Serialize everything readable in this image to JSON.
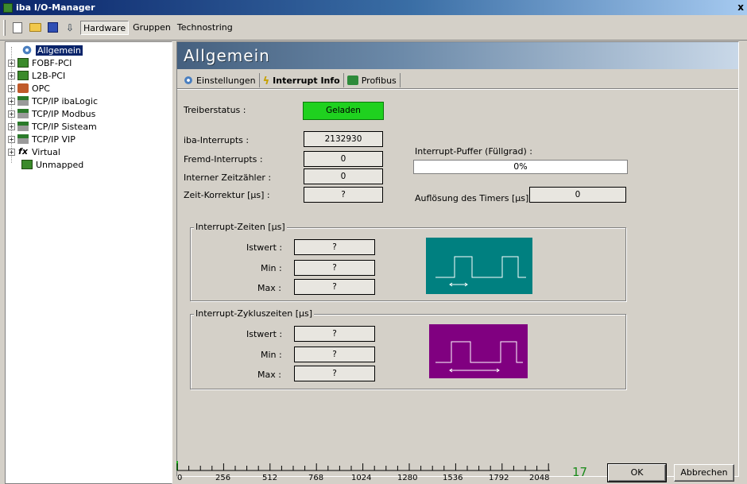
{
  "window": {
    "title": "iba I/O-Manager",
    "close": "x"
  },
  "toolbar": {
    "items": [
      "Hardware",
      "Gruppen",
      "Technostring"
    ]
  },
  "tree": {
    "items": [
      {
        "label": "Allgemein",
        "icon": "gear-icon",
        "expander": ""
      },
      {
        "label": "FOBF-PCI",
        "icon": "board-icon",
        "expander": "+"
      },
      {
        "label": "L2B-PCI",
        "icon": "board-icon",
        "expander": "+"
      },
      {
        "label": "OPC",
        "icon": "opc-icon",
        "expander": "+"
      },
      {
        "label": "TCP/IP ibaLogic",
        "icon": "network-icon",
        "expander": "+"
      },
      {
        "label": "TCP/IP Modbus",
        "icon": "network-icon",
        "expander": "+"
      },
      {
        "label": "TCP/IP Sisteam",
        "icon": "network-icon",
        "expander": "+"
      },
      {
        "label": "TCP/IP VIP",
        "icon": "network-icon",
        "expander": "+"
      },
      {
        "label": "Virtual",
        "icon": "fx-icon",
        "expander": "+"
      },
      {
        "label": "Unmapped",
        "icon": "board-icon",
        "expander": ""
      }
    ]
  },
  "header": {
    "title": "Allgemein"
  },
  "tabs": [
    "Einstellungen",
    "Interrupt Info",
    "Profibus"
  ],
  "status": {
    "treiber_label": "Treiberstatus :",
    "treiber_value": "Geladen",
    "iba_label": "iba-Interrupts :",
    "iba_value": "2132930",
    "fremd_label": "Fremd-Interrupts :",
    "fremd_value": "0",
    "zeitzaehler_label": "Interner Zeitzähler :",
    "zeitzaehler_value": "0",
    "korrektur_label": "Zeit-Korrektur [µs] :",
    "korrektur_value": "?",
    "puffer_label": "Interrupt-Puffer (Füllgrad) :",
    "puffer_value": "0%",
    "aufloesung_label": "Auflösung des Timers  [µs] :",
    "aufloesung_value": "0"
  },
  "group1": {
    "title": "Interrupt-Zeiten [µs]",
    "istwert_label": "Istwert :",
    "istwert_value": "?",
    "min_label": "Min :",
    "min_value": "?",
    "max_label": "Max :",
    "max_value": "?",
    "wave_color": "#008080"
  },
  "group2": {
    "title": "Interrupt-Zykluszeiten [µs]",
    "istwert_label": "Istwert :",
    "istwert_value": "?",
    "min_label": "Min :",
    "min_value": "?",
    "max_label": "Max :",
    "max_value": "?",
    "wave_color": "#800080"
  },
  "scale": {
    "labels": [
      "0",
      "256",
      "512",
      "768",
      "1024",
      "1280",
      "1536",
      "1792",
      "2048"
    ]
  },
  "count": "17",
  "buttons": {
    "ok": "OK",
    "cancel": "Abbrechen"
  }
}
